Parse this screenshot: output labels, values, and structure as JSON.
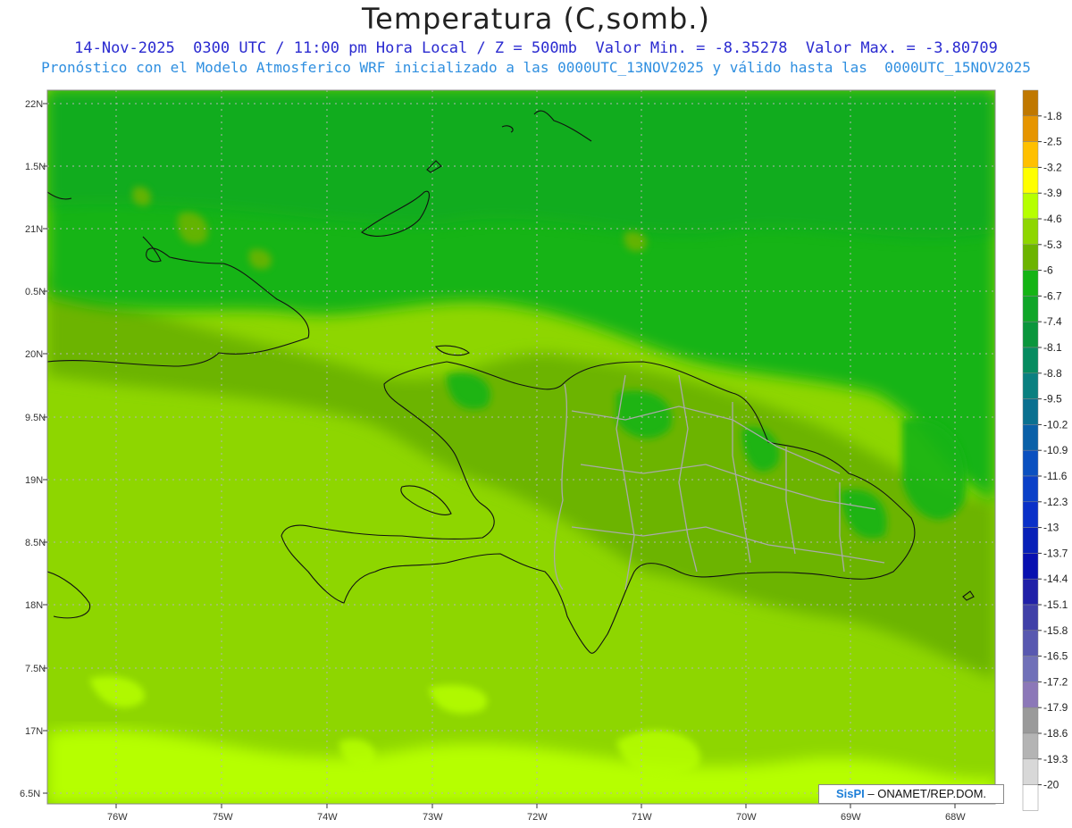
{
  "header": {
    "title": "Temperatura (C,somb.)",
    "line1": "14-Nov-2025  0300 UTC / 11:00 pm Hora Local / Z = 500mb  Valor Min. = -8.35278  Valor Max. = -3.80709",
    "line2": "Pronóstico con el Modelo Atmosferico WRF inicializado a las 0000UTC_13NOV2025 y válido hasta las  0000UTC_15NOV2025"
  },
  "axes": {
    "lat_labels": [
      "22N",
      "1.5N",
      "21N",
      "0.5N",
      "20N",
      "9.5N",
      "19N",
      "8.5N",
      "18N",
      "7.5N",
      "17N",
      "6.5N"
    ],
    "lon_labels": [
      "76W",
      "75W",
      "74W",
      "73W",
      "72W",
      "71W",
      "70W",
      "69W",
      "68W"
    ]
  },
  "colorbar": {
    "labels": [
      "-1.8",
      "-2.5",
      "-3.2",
      "-3.9",
      "-4.6",
      "-5.3",
      "-6",
      "-6.7",
      "-7.4",
      "-8.1",
      "-8.8",
      "-9.5",
      "-10.2",
      "-10.9",
      "-11.6",
      "-12.3",
      "-13",
      "-13.7",
      "-14.4",
      "-15.1",
      "-15.8",
      "-16.5",
      "-17.2",
      "-17.9",
      "-18.6",
      "-19.3",
      "-20"
    ],
    "colors": [
      "#c07800",
      "#e69500",
      "#ffc000",
      "#ffff00",
      "#b6ff00",
      "#8ed600",
      "#6cb400",
      "#14b414",
      "#10a628",
      "#0a963c",
      "#068c60",
      "#0a8080",
      "#0a7090",
      "#0a60a8",
      "#0a50c0",
      "#0a40c8",
      "#0a30c8",
      "#0820b8",
      "#0810b0",
      "#2020a8",
      "#4040a8",
      "#5858b0",
      "#7070b8",
      "#8c78b8",
      "#9a9a9a",
      "#b4b4b4",
      "#d8d8d8",
      "#ffffff"
    ]
  },
  "credit": {
    "logo": "SisPI",
    "text": "– ONAMET/REP.DOM."
  }
}
